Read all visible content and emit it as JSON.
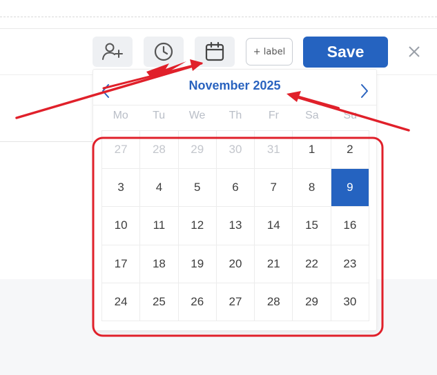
{
  "toolbar": {
    "add_user_icon": "add-user-icon",
    "clock_icon": "clock-icon",
    "calendar_icon": "calendar-icon",
    "label_button": "+ label",
    "save_button": "Save",
    "close_icon": "close-icon"
  },
  "calendar": {
    "month_title": "November 2025",
    "prev_icon": "chevron-left-icon",
    "next_icon": "chevron-right-icon",
    "weekdays": [
      "Mo",
      "Tu",
      "We",
      "Th",
      "Fr",
      "Sa",
      "Su"
    ],
    "days": [
      {
        "label": "27",
        "muted": true
      },
      {
        "label": "28",
        "muted": true
      },
      {
        "label": "29",
        "muted": true
      },
      {
        "label": "30",
        "muted": true
      },
      {
        "label": "31",
        "muted": true
      },
      {
        "label": "1"
      },
      {
        "label": "2"
      },
      {
        "label": "3"
      },
      {
        "label": "4"
      },
      {
        "label": "5"
      },
      {
        "label": "6"
      },
      {
        "label": "7"
      },
      {
        "label": "8"
      },
      {
        "label": "9",
        "selected": true
      },
      {
        "label": "10"
      },
      {
        "label": "11"
      },
      {
        "label": "12"
      },
      {
        "label": "13"
      },
      {
        "label": "14"
      },
      {
        "label": "15"
      },
      {
        "label": "16"
      },
      {
        "label": "17"
      },
      {
        "label": "18"
      },
      {
        "label": "19"
      },
      {
        "label": "20"
      },
      {
        "label": "21"
      },
      {
        "label": "22"
      },
      {
        "label": "23"
      },
      {
        "label": "24"
      },
      {
        "label": "25"
      },
      {
        "label": "26"
      },
      {
        "label": "27"
      },
      {
        "label": "28"
      },
      {
        "label": "29"
      },
      {
        "label": "30"
      }
    ]
  },
  "colors": {
    "accent": "#2563c0",
    "annotation": "#e0202a"
  }
}
